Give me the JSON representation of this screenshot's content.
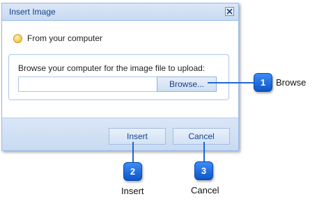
{
  "dialog": {
    "title": "Insert Image",
    "radio_label": "From your computer",
    "fieldset_label": "Browse your computer for the image file to upload:",
    "file_input_value": "",
    "browse_label": "Browse...",
    "insert_label": "Insert",
    "cancel_label": "Cancel"
  },
  "callouts": [
    {
      "number": "1",
      "label": "Browse"
    },
    {
      "number": "2",
      "label": "Insert"
    },
    {
      "number": "3",
      "label": "Cancel"
    }
  ],
  "colors": {
    "callout_blue": "#1f66d1",
    "title_text": "#15428b",
    "border": "#99bbe8"
  }
}
